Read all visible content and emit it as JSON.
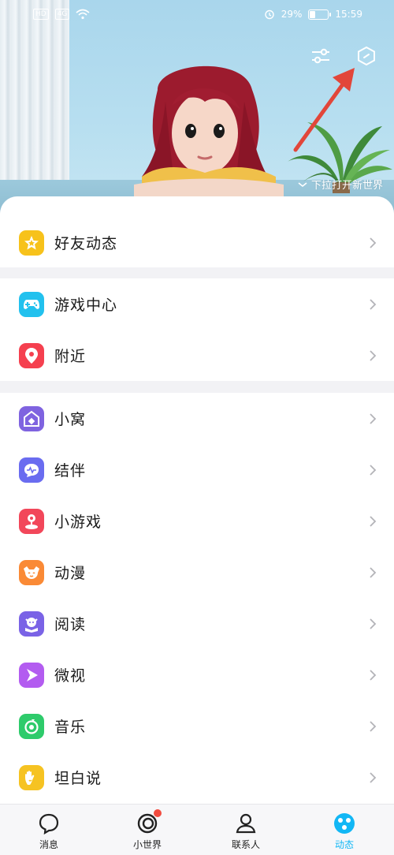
{
  "status_bar": {
    "left_chips": [
      "HD",
      "4G"
    ],
    "battery_percent": "29%",
    "battery_level": 0.29,
    "time": "15:59"
  },
  "header": {
    "pull_hint": "下拉打开新世界",
    "actions": [
      {
        "name": "filter-settings-icon"
      },
      {
        "name": "hexagon-settings-icon"
      }
    ]
  },
  "groups": [
    {
      "items": [
        {
          "label": "好友动态",
          "icon": "star-icon",
          "color": "#f7c21b"
        }
      ]
    },
    {
      "items": [
        {
          "label": "游戏中心",
          "icon": "gamepad-icon",
          "color": "#22c1ee"
        },
        {
          "label": "附近",
          "icon": "location-pin-icon",
          "color": "#f5404f"
        }
      ]
    },
    {
      "items": [
        {
          "label": "小窝",
          "icon": "home-icon",
          "color": "#7f63e0"
        },
        {
          "label": "结伴",
          "icon": "chat-wave-icon",
          "color": "#6a6cf0"
        },
        {
          "label": "小游戏",
          "icon": "joystick-icon",
          "color": "#f2475a"
        },
        {
          "label": "动漫",
          "icon": "anime-face-icon",
          "color": "#fa8a36"
        },
        {
          "label": "阅读",
          "icon": "reading-icon",
          "color": "#7a63e6"
        },
        {
          "label": "微视",
          "icon": "play-icon",
          "color": "#b35cf0"
        },
        {
          "label": "音乐",
          "icon": "music-icon",
          "color": "#2ecb6b"
        },
        {
          "label": "坦白说",
          "icon": "hand-icon",
          "color": "#f6c322"
        }
      ]
    }
  ],
  "bottom_nav": [
    {
      "label": "消息",
      "icon": "message-bubble-icon",
      "active": false
    },
    {
      "label": "小世界",
      "icon": "small-world-icon",
      "active": false,
      "badge": true
    },
    {
      "label": "联系人",
      "icon": "contacts-icon",
      "active": false
    },
    {
      "label": "动态",
      "icon": "dynamic-icon",
      "active": true
    }
  ],
  "colors": {
    "accent": "#12b7f5",
    "badge": "#f24b3f",
    "arrow": "#e2463a"
  }
}
